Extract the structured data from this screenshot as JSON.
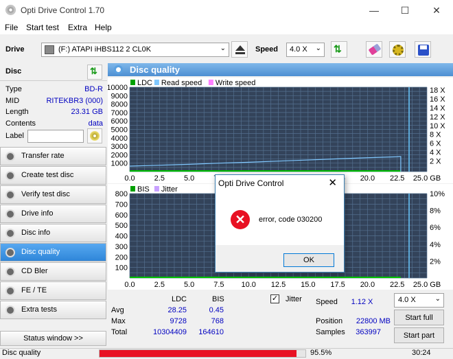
{
  "title": "Opti Drive Control 1.70",
  "menu": [
    "File",
    "Start test",
    "Extra",
    "Help"
  ],
  "toolbar": {
    "drive_label": "Drive",
    "drive_value": "(F:)  ATAPI iHBS112  2 CL0K",
    "speed_label": "Speed",
    "speed_value": "4.0 X"
  },
  "disc": {
    "header": "Disc",
    "rows": [
      {
        "k": "Type",
        "v": "BD-R"
      },
      {
        "k": "MID",
        "v": "RITEKBR3 (000)"
      },
      {
        "k": "Length",
        "v": "23.31 GB"
      },
      {
        "k": "Contents",
        "v": "data"
      }
    ],
    "label_label": "Label"
  },
  "nav": [
    "Transfer rate",
    "Create test disc",
    "Verify test disc",
    "Drive info",
    "Disc info",
    "Disc quality",
    "CD Bler",
    "FE / TE",
    "Extra tests"
  ],
  "status_window": "Status window >>",
  "main": {
    "header": "Disc quality"
  },
  "chart_data": [
    {
      "type": "line",
      "legend": [
        "LDC",
        "Read speed",
        "Write speed"
      ],
      "legend_colors": [
        "#00a000",
        "#80c8ff",
        "#ff80ff"
      ],
      "x_ticks": [
        "0.0",
        "2.5",
        "5.0",
        "7.5",
        "10.0",
        "12.5",
        "15.0",
        "17.5",
        "20.0",
        "22.5",
        "25.0 GB"
      ],
      "y_ticks": [
        "10000",
        "9000",
        "8000",
        "7000",
        "6000",
        "5000",
        "4000",
        "3000",
        "2000",
        "1000"
      ],
      "y2_ticks": [
        "18 X",
        "16 X",
        "14 X",
        "12 X",
        "10 X",
        "8 X",
        "6 X",
        "4 X",
        "2 X"
      ],
      "xlim": [
        0,
        25
      ],
      "ylim": [
        0,
        10000
      ],
      "read_speed": {
        "x": [
          0,
          2.5,
          5,
          7.5,
          10,
          12.5,
          15,
          17.5,
          20,
          22.5,
          22.8
        ],
        "y": [
          1.2,
          1.4,
          1.6,
          1.85,
          2.05,
          2.3,
          2.55,
          2.8,
          3.05,
          3.25,
          3.3
        ]
      },
      "ldc_avg": 28.25,
      "marker_x": 23.5
    },
    {
      "type": "line",
      "legend": [
        "BIS",
        "Jitter"
      ],
      "legend_colors": [
        "#00a000",
        "#c8a0ff"
      ],
      "x_ticks": [
        "0.0",
        "2.5",
        "5.0",
        "7.5",
        "10.0",
        "12.5",
        "15.0",
        "17.5",
        "20.0",
        "22.5",
        "25.0 GB"
      ],
      "y_ticks": [
        "800",
        "700",
        "600",
        "500",
        "400",
        "300",
        "200",
        "100"
      ],
      "y2_ticks": [
        "10%",
        "8%",
        "6%",
        "4%",
        "2%"
      ],
      "xlim": [
        0,
        25
      ],
      "ylim": [
        0,
        800
      ],
      "marker_x": 23.5
    }
  ],
  "stats": {
    "col_ldc": "LDC",
    "col_bis": "BIS",
    "jitter_label": "Jitter",
    "rows": [
      {
        "k": "Avg",
        "ldc": "28.25",
        "bis": "0.45"
      },
      {
        "k": "Max",
        "ldc": "9728",
        "bis": "768"
      },
      {
        "k": "Total",
        "ldc": "10304409",
        "bis": "164610"
      }
    ],
    "speed_label": "Speed",
    "speed_value": "1.12 X",
    "speed_select": "4.0 X",
    "position_label": "Position",
    "position_value": "22800 MB",
    "samples_label": "Samples",
    "samples_value": "363997",
    "start_full": "Start full",
    "start_part": "Start part"
  },
  "dialog": {
    "title": "Opti Drive Control",
    "message": "error, code 030200",
    "ok": "OK"
  },
  "statusbar": {
    "label": "Disc quality",
    "progress": 95.5,
    "progress_text": "95.5%",
    "time": "30:24"
  }
}
